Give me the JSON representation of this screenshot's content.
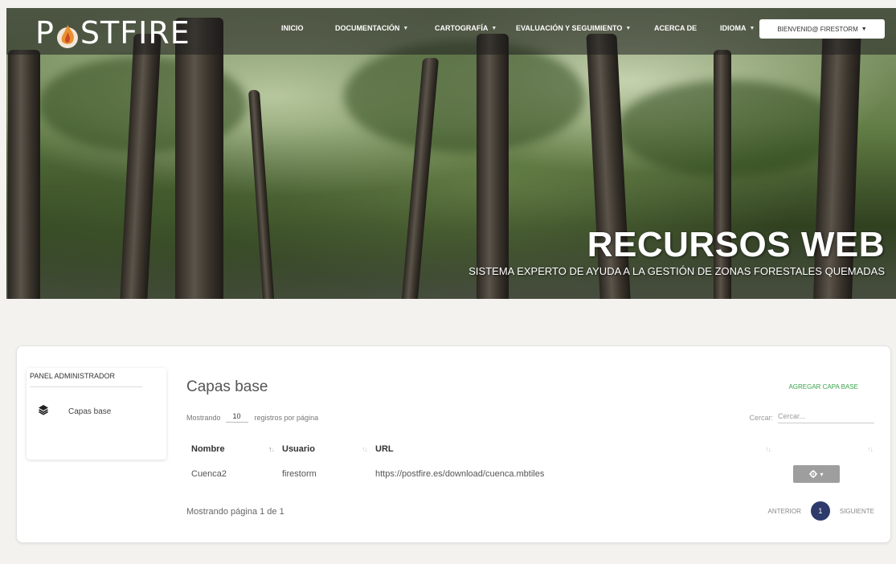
{
  "brand": {
    "prefix": "P",
    "suffix": "STFIRE"
  },
  "nav": {
    "items": [
      {
        "label": "Inicio",
        "dropdown": false
      },
      {
        "label": "Documentación",
        "dropdown": true
      },
      {
        "label": "Cartografía",
        "dropdown": true
      },
      {
        "label": "Evaluación y seguimiento",
        "dropdown": true
      },
      {
        "label": "Acerca de",
        "dropdown": false
      },
      {
        "label": "Idioma",
        "dropdown": true
      }
    ],
    "user_label": "Bienvenid@ firestorm"
  },
  "hero": {
    "title": "RECURSOS WEB",
    "subtitle": "SISTEMA EXPERTO DE AYUDA A LA GESTIÓN DE ZONAS FORESTALES QUEMADAS"
  },
  "sidebar": {
    "title": "Panel administrador",
    "items": [
      {
        "label": "Capas base",
        "icon": "layers-icon"
      }
    ]
  },
  "section": {
    "title": "Capas base",
    "add_label": "Agregar capa base"
  },
  "table_controls": {
    "showing_label": "Mostrando",
    "page_length": "10",
    "per_page_label": "registros por página",
    "search_label": "Cercar:",
    "search_placeholder": "Cercar..."
  },
  "table": {
    "columns": [
      "Nombre",
      "Usuario",
      "URL",
      "",
      ""
    ],
    "rows": [
      {
        "nombre": "Cuenca2",
        "usuario": "firestorm",
        "url": "https://postfire.es/download/cuenca.mbtiles"
      }
    ]
  },
  "pagination": {
    "info": "Mostrando página 1 de 1",
    "prev_label": "Anterior",
    "current_page": "1",
    "next_label": "Siguiente"
  },
  "colors": {
    "accent_green": "#3aa34a",
    "page_active": "#2d3a6b",
    "action_button": "#9e9e9e"
  }
}
